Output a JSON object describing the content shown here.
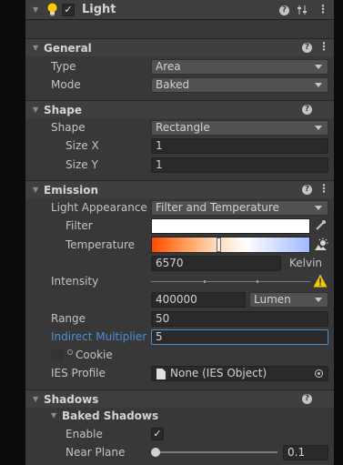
{
  "component": {
    "title": "Light",
    "enabled": true,
    "icons": [
      "help-icon",
      "preset-icon",
      "kebab-icon"
    ]
  },
  "general": {
    "title": "General",
    "type_label": "Type",
    "type_value": "Area",
    "mode_label": "Mode",
    "mode_value": "Baked"
  },
  "shape": {
    "title": "Shape",
    "shape_label": "Shape",
    "shape_value": "Rectangle",
    "size_x_label": "Size X",
    "size_x_value": "1",
    "size_y_label": "Size Y",
    "size_y_value": "1"
  },
  "emission": {
    "title": "Emission",
    "appearance_label": "Light Appearance",
    "appearance_value": "Filter and Temperature",
    "filter_label": "Filter",
    "filter_color": "#ffffff",
    "temperature_label": "Temperature",
    "temperature_value": "6570",
    "temperature_unit": "Kelvin",
    "temperature_slider_fraction": 0.42,
    "intensity_label": "Intensity",
    "intensity_value": "400000",
    "intensity_unit": "Lumen",
    "range_label": "Range",
    "range_value": "50",
    "indirect_label": "Indirect Multiplier",
    "indirect_value": "5",
    "cookie_label": "Cookie",
    "ies_label": "IES Profile",
    "ies_value": "None (IES Object)"
  },
  "shadows": {
    "title": "Shadows",
    "baked_title": "Baked Shadows",
    "enable_label": "Enable",
    "enable_checked": true,
    "near_plane_label": "Near Plane",
    "near_plane_value": "0.1",
    "near_plane_fraction": 0.0
  },
  "colors": {
    "panel_bg": "#383838",
    "header_bg": "#3e3e3e",
    "field_bg": "#2a2a2a",
    "dropdown_bg": "#515151",
    "highlight_blue": "#4a8fd6",
    "warning_yellow": "#f5c800",
    "bulb_yellow": "#ffcc00"
  }
}
